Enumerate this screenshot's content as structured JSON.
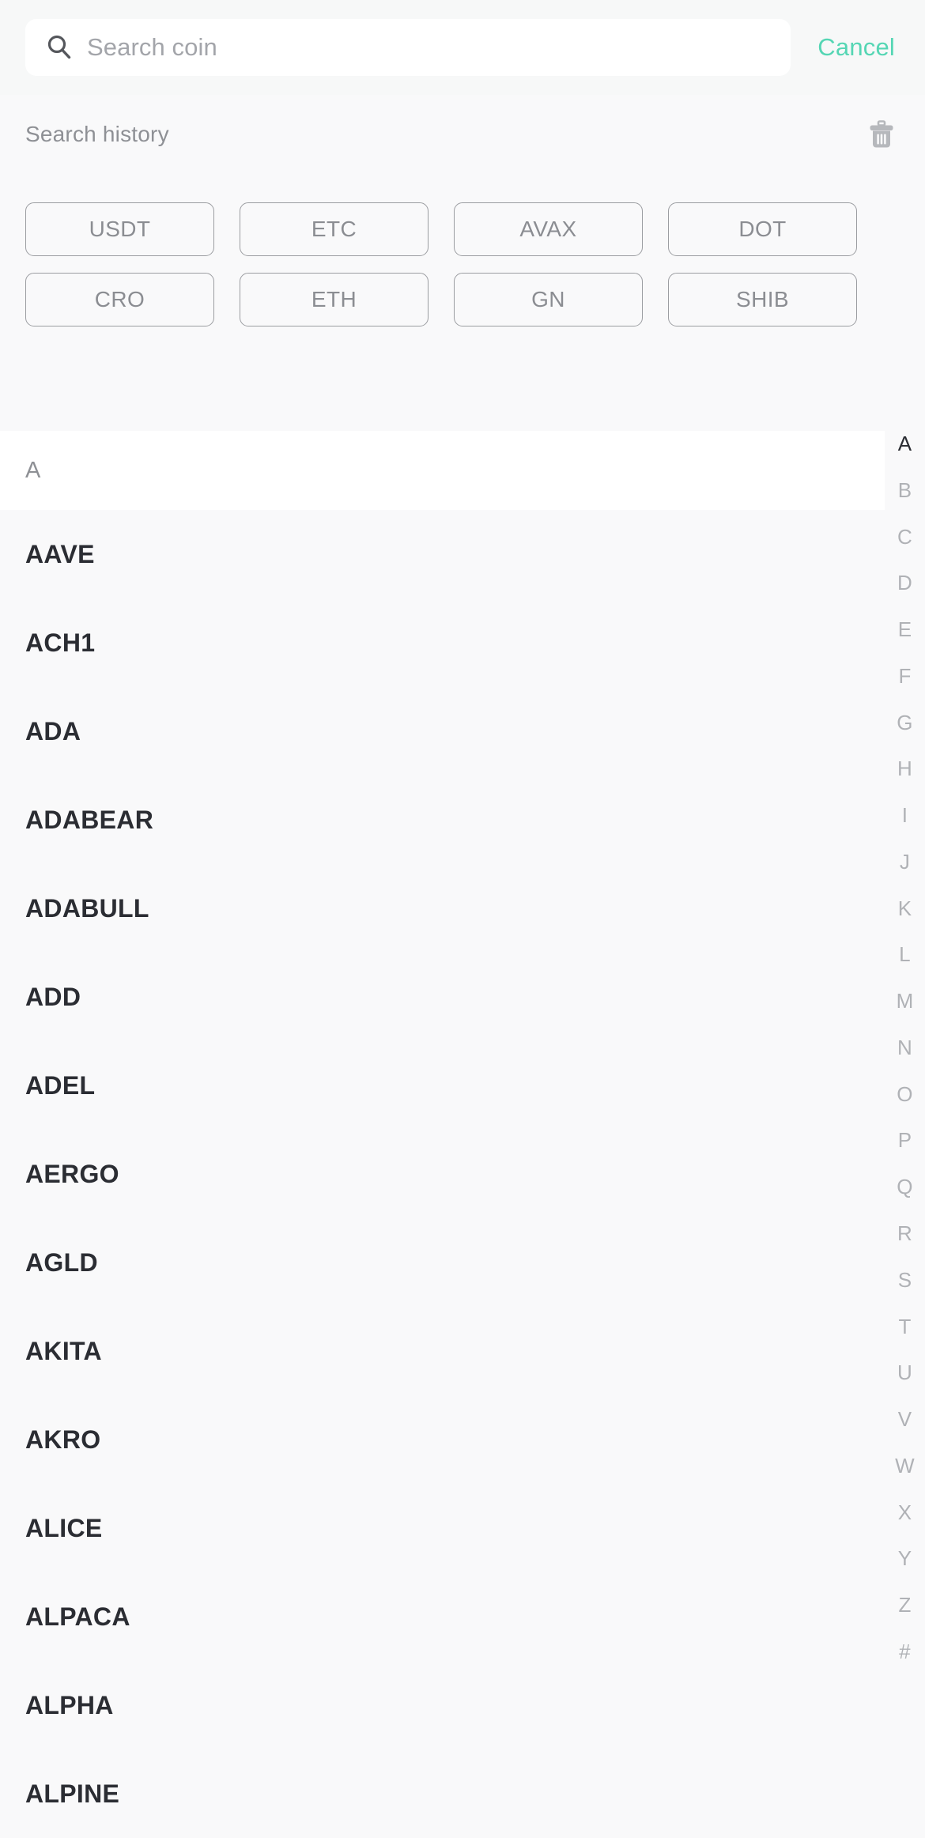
{
  "search": {
    "placeholder": "Search coin",
    "value": "",
    "icon": "search-icon",
    "cancel_label": "Cancel"
  },
  "history": {
    "title": "Search history",
    "clear_icon": "trash-icon",
    "chips": [
      "USDT",
      "ETC",
      "AVAX",
      "DOT",
      "CRO",
      "ETH",
      "GN",
      "SHIB"
    ]
  },
  "coin_list": {
    "section_label": "A",
    "coins": [
      "AAVE",
      "ACH1",
      "ADA",
      "ADABEAR",
      "ADABULL",
      "ADD",
      "ADEL",
      "AERGO",
      "AGLD",
      "AKITA",
      "AKRO",
      "ALICE",
      "ALPACA",
      "ALPHA",
      "ALPINE"
    ]
  },
  "index_rail": {
    "active": "A",
    "letters": [
      "A",
      "B",
      "C",
      "D",
      "E",
      "F",
      "G",
      "H",
      "I",
      "J",
      "K",
      "L",
      "M",
      "N",
      "O",
      "P",
      "Q",
      "R",
      "S",
      "T",
      "U",
      "V",
      "W",
      "X",
      "Y",
      "Z",
      "#"
    ]
  },
  "colors": {
    "accent": "#55d6b4",
    "text_primary": "#2b2d33",
    "text_muted": "#8e9095",
    "background": "#f9f9fa",
    "surface": "#ffffff",
    "chip_border": "#9b9da1"
  }
}
